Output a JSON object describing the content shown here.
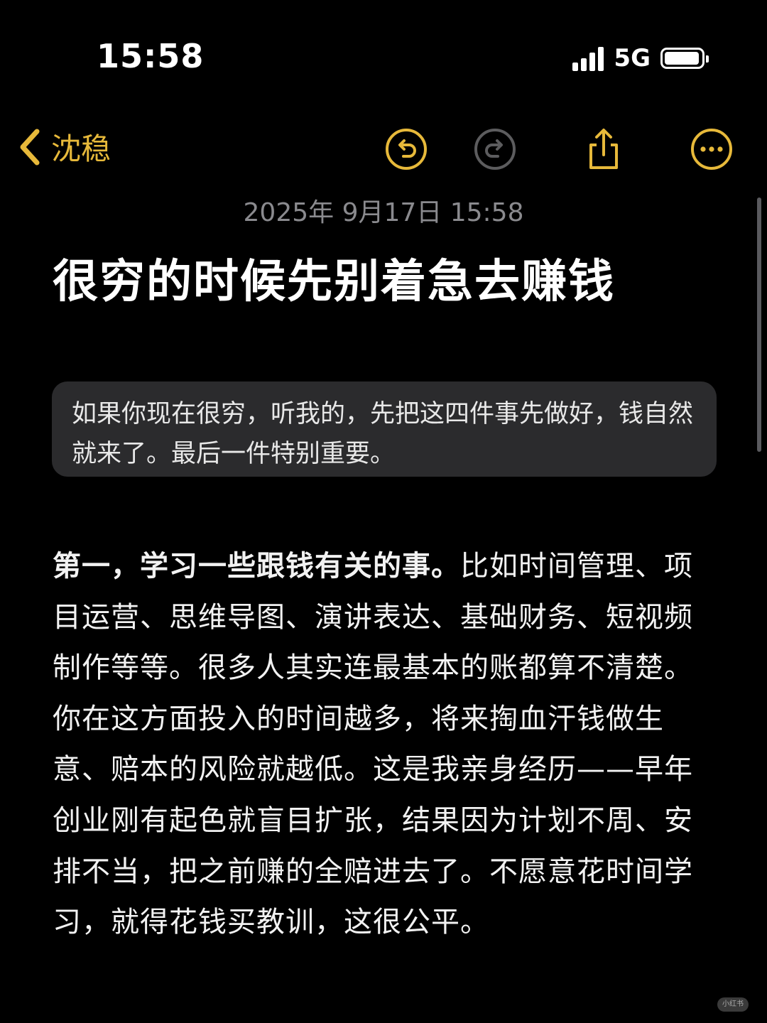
{
  "status_bar": {
    "time": "15:58",
    "network": "5G",
    "signal_bars": 4,
    "battery_level": 0.95
  },
  "nav": {
    "back_label": "沈稳",
    "icons": [
      "chevron-left-icon",
      "undo-icon",
      "redo-icon",
      "share-icon",
      "more-icon"
    ],
    "accent_color": "#e7b93a",
    "disabled_color": "#5c5c5e"
  },
  "note": {
    "date": "2025年 9月17日 15:58",
    "title": "很穷的时候先别着急去赚钱",
    "quote": "如果你现在很穷，听我的，先把这四件事先做好，钱自然就来了。最后一件特别重要。",
    "body_lead": "第一，学习一些跟钱有关的事。",
    "body_rest": "比如时间管理、项目运营、思维导图、演讲表达、基础财务、短视频制作等等。很多人其实连最基本的账都算不清楚。你在这方面投入的时间越多，将来掏血汗钱做生意、赔本的风险就越低。这是我亲身经历——早年创业刚有起色就盲目扩张，结果因为计划不周、安排不当，把之前赚的全赔进去了。不愿意花时间学习，就得花钱买教训，这很公平。"
  },
  "watermark": "小红书"
}
